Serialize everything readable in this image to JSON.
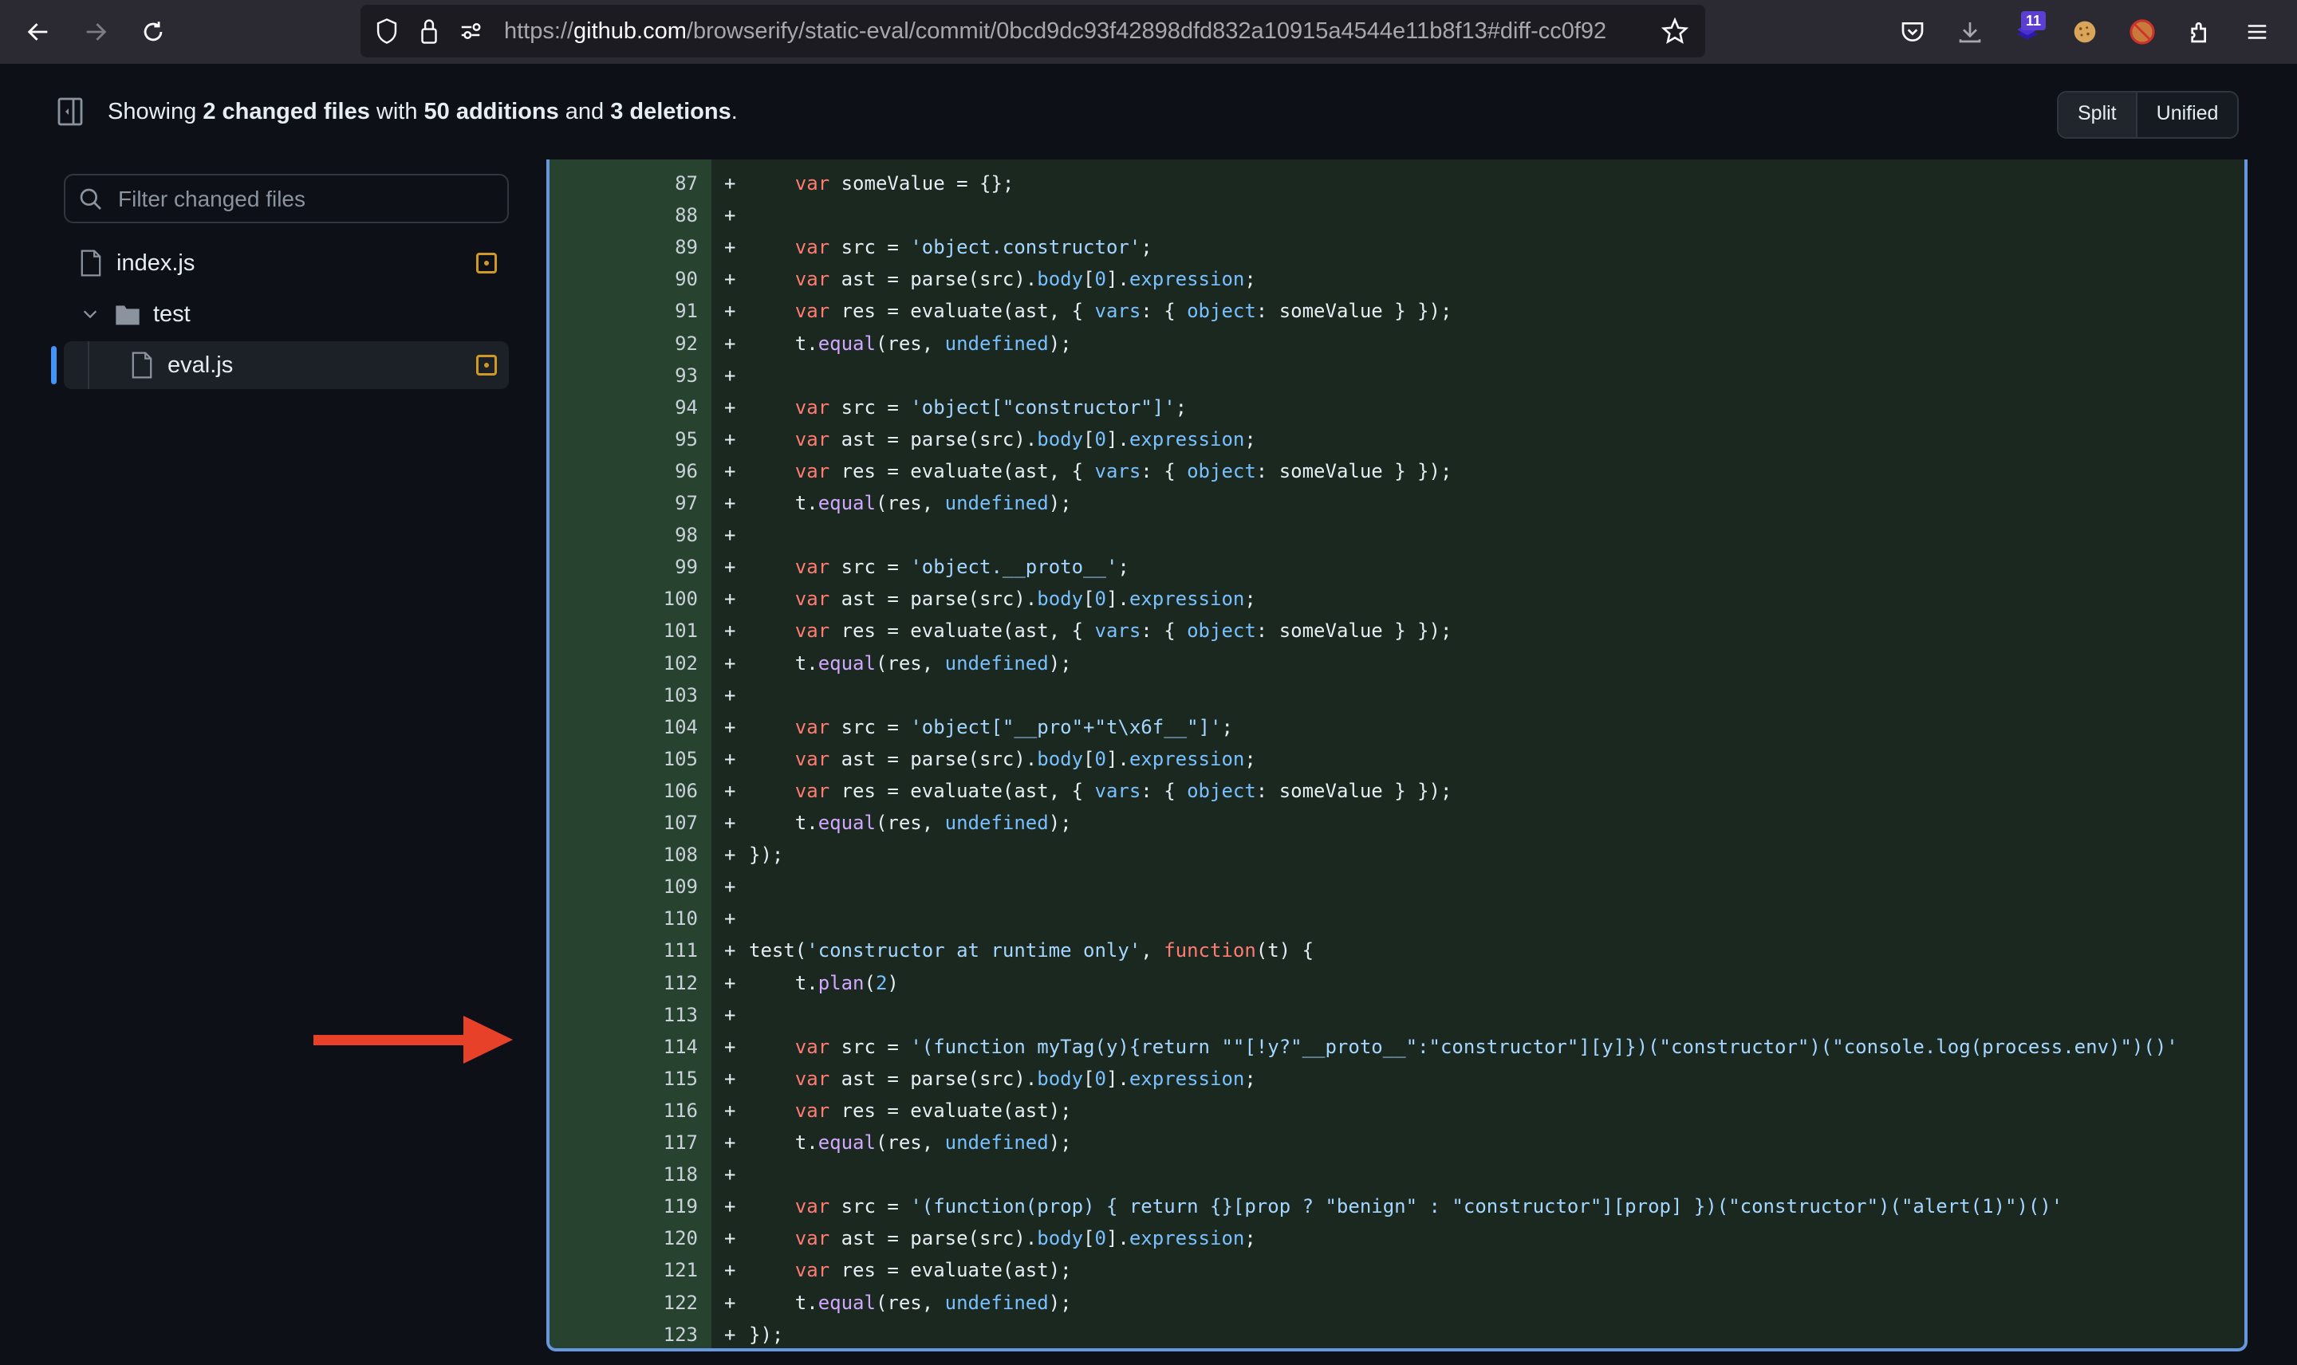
{
  "browser": {
    "url_prefix": "https://",
    "url_host": "github.com",
    "url_path": "/browserify/static-eval/commit/0bcd9dc93f42898dfd832a10915a4544e11b8f13#diff-cc0f92",
    "extension_badge": "11",
    "icons": [
      "back-icon",
      "forward-icon",
      "reload-icon",
      "shield-icon",
      "lock-icon",
      "permissions-icon",
      "bookmark-star-icon",
      "pocket-icon",
      "download-icon",
      "extension-layers-icon",
      "cookie-icon",
      "blocked-fox-icon",
      "extensions-puzzle-icon",
      "menu-icon"
    ]
  },
  "header": {
    "summary_prefix": "Showing ",
    "files_changed": "2 changed files",
    "summary_mid": " with ",
    "additions": "50 additions",
    "summary_and": " and ",
    "deletions": "3 deletions",
    "summary_end": ".",
    "view_split": "Split",
    "view_unified": "Unified"
  },
  "sidebar": {
    "filter_placeholder": "Filter changed files",
    "files": [
      {
        "name": "index.js",
        "type": "file",
        "status": "modified"
      },
      {
        "name": "test",
        "type": "folder",
        "expanded": true
      },
      {
        "name": "eval.js",
        "type": "file",
        "status": "modified",
        "selected": true
      }
    ]
  },
  "diff": {
    "accent": "#6797e0",
    "lines": [
      {
        "n": "87",
        "code": "    <k>var</k> someValue = {};"
      },
      {
        "n": "88",
        "code": ""
      },
      {
        "n": "89",
        "code": "    <k>var</k> src = <s>'object.constructor'</s>;"
      },
      {
        "n": "90",
        "code": "    <k>var</k> ast = parse(src).<p>body</p>[<p>0</p>].<p>expression</p>;"
      },
      {
        "n": "91",
        "code": "    <k>var</k> res = evaluate(ast, { <p>vars</p>: { <p>object</p>: someValue } });"
      },
      {
        "n": "92",
        "code": "    t.<f>equal</f>(res, <p>undefined</p>);"
      },
      {
        "n": "93",
        "code": ""
      },
      {
        "n": "94",
        "code": "    <k>var</k> src = <s>'object[\"constructor\"]'</s>;"
      },
      {
        "n": "95",
        "code": "    <k>var</k> ast = parse(src).<p>body</p>[<p>0</p>].<p>expression</p>;"
      },
      {
        "n": "96",
        "code": "    <k>var</k> res = evaluate(ast, { <p>vars</p>: { <p>object</p>: someValue } });"
      },
      {
        "n": "97",
        "code": "    t.<f>equal</f>(res, <p>undefined</p>);"
      },
      {
        "n": "98",
        "code": ""
      },
      {
        "n": "99",
        "code": "    <k>var</k> src = <s>'object.__proto__'</s>;"
      },
      {
        "n": "100",
        "code": "    <k>var</k> ast = parse(src).<p>body</p>[<p>0</p>].<p>expression</p>;"
      },
      {
        "n": "101",
        "code": "    <k>var</k> res = evaluate(ast, { <p>vars</p>: { <p>object</p>: someValue } });"
      },
      {
        "n": "102",
        "code": "    t.<f>equal</f>(res, <p>undefined</p>);"
      },
      {
        "n": "103",
        "code": ""
      },
      {
        "n": "104",
        "code": "    <k>var</k> src = <s>'object[\"__pro\"+\"t\\x6f__\"]'</s>;"
      },
      {
        "n": "105",
        "code": "    <k>var</k> ast = parse(src).<p>body</p>[<p>0</p>].<p>expression</p>;"
      },
      {
        "n": "106",
        "code": "    <k>var</k> res = evaluate(ast, { <p>vars</p>: { <p>object</p>: someValue } });"
      },
      {
        "n": "107",
        "code": "    t.<f>equal</f>(res, <p>undefined</p>);"
      },
      {
        "n": "108",
        "code": "});"
      },
      {
        "n": "109",
        "code": ""
      },
      {
        "n": "110",
        "code": ""
      },
      {
        "n": "111",
        "code": "test(<s>'constructor at runtime only'</s>, <k>function</k>(t) {"
      },
      {
        "n": "112",
        "code": "    t.<f>plan</f>(<p>2</p>)"
      },
      {
        "n": "113",
        "code": ""
      },
      {
        "n": "114",
        "code": "    <k>var</k> src = <s>'(function myTag(y){return \"\"[!y?\"__proto__\":\"constructor\"][y]})(\"constructor\")(\"console.log(process.env)\")()'</s>"
      },
      {
        "n": "115",
        "code": "    <k>var</k> ast = parse(src).<p>body</p>[<p>0</p>].<p>expression</p>;"
      },
      {
        "n": "116",
        "code": "    <k>var</k> res = evaluate(ast);"
      },
      {
        "n": "117",
        "code": "    t.<f>equal</f>(res, <p>undefined</p>);"
      },
      {
        "n": "118",
        "code": ""
      },
      {
        "n": "119",
        "code": "    <k>var</k> src = <s>'(function(prop) { return {}[prop ? \"benign\" : \"constructor\"][prop] })(\"constructor\")(\"alert(1)\")()'</s>"
      },
      {
        "n": "120",
        "code": "    <k>var</k> ast = parse(src).<p>body</p>[<p>0</p>].<p>expression</p>;"
      },
      {
        "n": "121",
        "code": "    <k>var</k> res = evaluate(ast);"
      },
      {
        "n": "122",
        "code": "    t.<f>equal</f>(res, <p>undefined</p>);"
      },
      {
        "n": "123",
        "code": "});"
      }
    ]
  },
  "annotation": {
    "type": "red-arrow",
    "points_to_line": "114",
    "color": "#e8412a"
  }
}
